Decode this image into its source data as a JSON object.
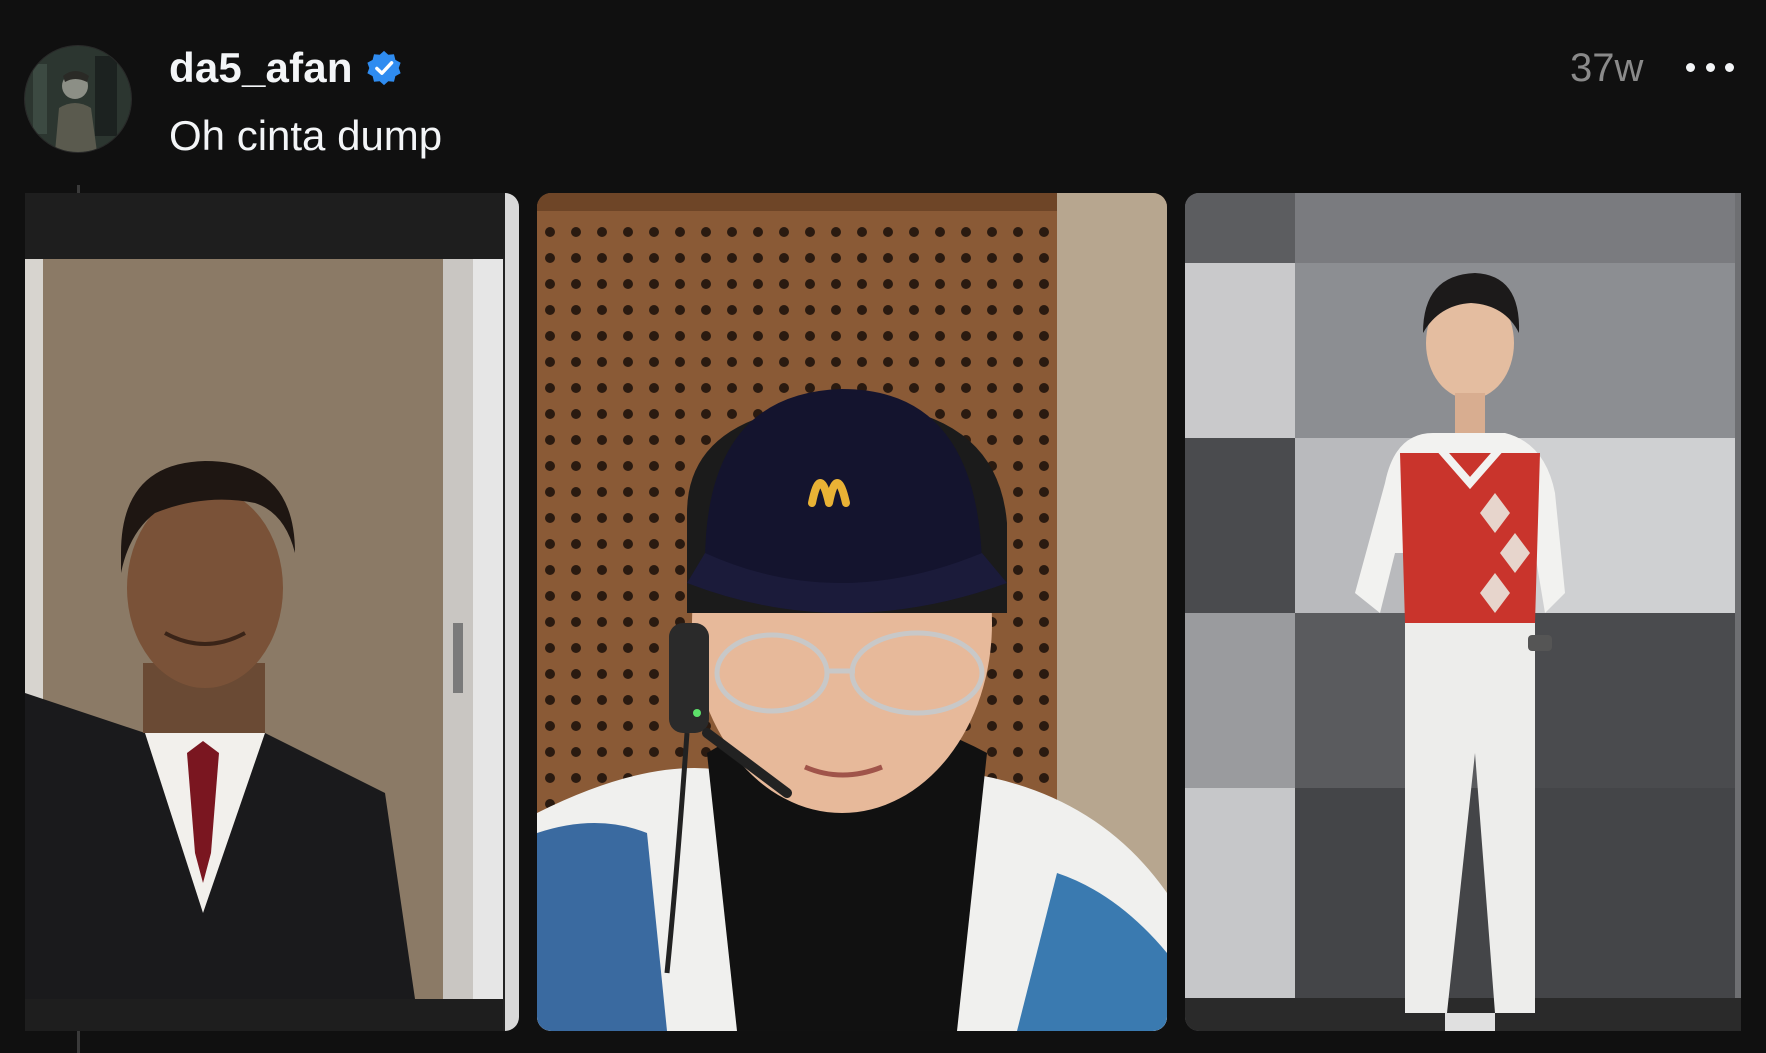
{
  "post": {
    "username": "da5_afan",
    "verified": true,
    "timestamp": "37w",
    "text": "Oh cinta dump",
    "more_icon": "more-horizontal-icon",
    "verified_icon": "verified-badge-icon"
  },
  "colors": {
    "background": "#101010",
    "text_primary": "#f3f5f7",
    "text_secondary": "#8a8a8a",
    "verified_blue": "#0095f6",
    "thread_line": "#3a3a3a"
  }
}
